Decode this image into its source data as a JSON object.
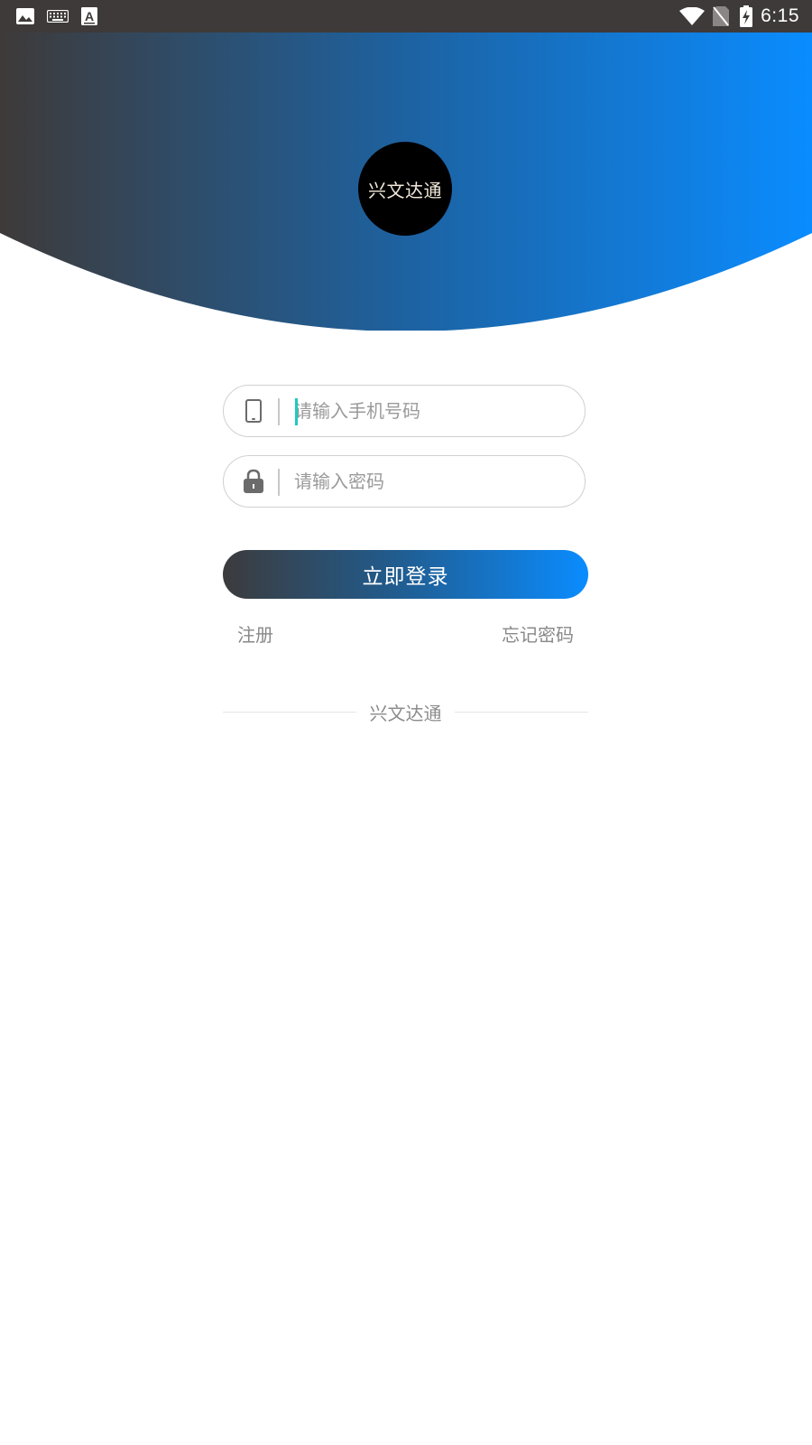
{
  "status_bar": {
    "time": "6:15",
    "left_icons": [
      "gallery-icon",
      "keyboard-icon",
      "font-a-icon"
    ],
    "right_icons": [
      "wifi-icon",
      "no-sim-icon",
      "battery-charging-icon"
    ],
    "background": "#3e3a39"
  },
  "header": {
    "gradient_start": "#3e3a39",
    "gradient_end": "#0a8cff",
    "logo_text": "兴文达通"
  },
  "form": {
    "phone": {
      "icon": "phone-icon",
      "placeholder": "请输入手机号码",
      "value": ""
    },
    "password": {
      "icon": "lock-icon",
      "placeholder": "请输入密码",
      "value": ""
    },
    "login_label": "立即登录",
    "register_label": "注册",
    "forgot_label": "忘记密码"
  },
  "footer": {
    "brand": "兴文达通"
  }
}
